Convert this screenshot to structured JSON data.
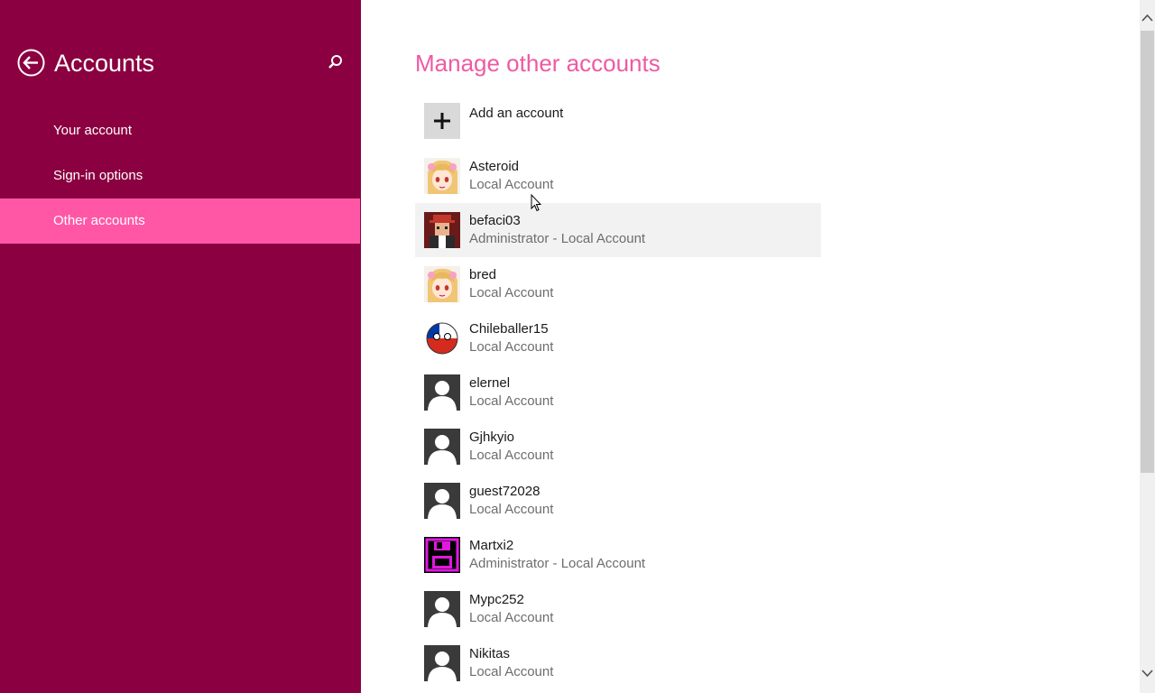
{
  "sidebar": {
    "title": "Accounts",
    "items": [
      {
        "label": "Your account"
      },
      {
        "label": "Sign-in options"
      },
      {
        "label": "Other accounts"
      }
    ]
  },
  "main": {
    "title": "Manage other accounts",
    "add_label": "Add an account",
    "accounts": [
      {
        "name": "Asteroid",
        "type": "Local Account",
        "avatar": "anime-girl-avatar"
      },
      {
        "name": "befaci03",
        "type": "Administrator - Local Account",
        "avatar": "character-avatar"
      },
      {
        "name": "bred",
        "type": "Local Account",
        "avatar": "anime-girl-avatar"
      },
      {
        "name": "Chileballer15",
        "type": "Local Account",
        "avatar": "chileball-avatar"
      },
      {
        "name": "elernel",
        "type": "Local Account",
        "avatar": "default-user-avatar"
      },
      {
        "name": "Gjhkyio",
        "type": "Local Account",
        "avatar": "default-user-avatar"
      },
      {
        "name": "guest72028",
        "type": "Local Account",
        "avatar": "default-user-avatar"
      },
      {
        "name": "Martxi2",
        "type": "Administrator - Local Account",
        "avatar": "floppy-disk-avatar"
      },
      {
        "name": "Mypc252",
        "type": "Local Account",
        "avatar": "default-user-avatar"
      },
      {
        "name": "Nikitas",
        "type": "Local Account",
        "avatar": "default-user-avatar"
      }
    ]
  },
  "colors": {
    "sidebar_bg": "#8b0040",
    "selected_bg": "#ff57a6",
    "title_accent": "#ee5aa3",
    "hover_row": "#f2f2f2"
  }
}
